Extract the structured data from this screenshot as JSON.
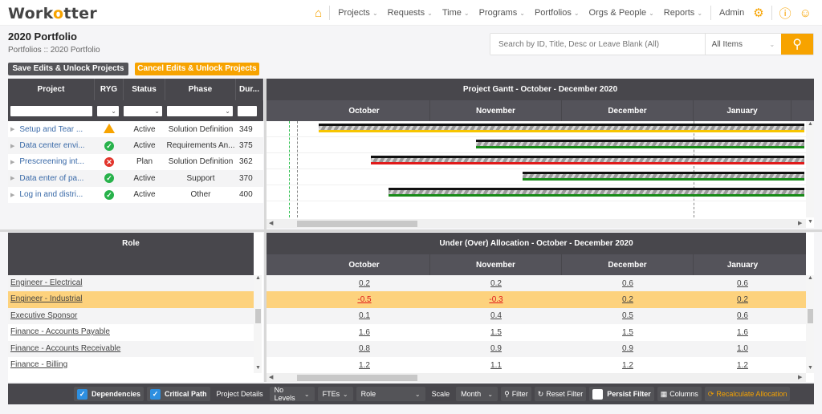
{
  "app": {
    "logo_prefix": "Work",
    "logo_mid": "o",
    "logo_suffix": "tter"
  },
  "nav": {
    "items": [
      {
        "label": "Projects"
      },
      {
        "label": "Requests"
      },
      {
        "label": "Time"
      },
      {
        "label": "Programs"
      },
      {
        "label": "Portfolios"
      },
      {
        "label": "Orgs & People"
      },
      {
        "label": "Reports"
      }
    ],
    "admin_label": "Admin",
    "home_icon": "home-icon",
    "gear_icon": "gear-icon",
    "help_icon": "help-icon",
    "user_icon": "user-icon"
  },
  "page": {
    "title": "2020 Portfolio",
    "breadcrumb": "Portfolios :: 2020 Portfolio"
  },
  "search": {
    "placeholder": "Search by ID, Title, Desc or Leave Blank (All)",
    "scope": "All Items"
  },
  "actions": {
    "save": "Save Edits & Unlock Projects",
    "cancel": "Cancel Edits & Unlock Projects"
  },
  "projects": {
    "columns": [
      "Project",
      "RYG",
      "Status",
      "Phase",
      "Dur..."
    ],
    "rows": [
      {
        "name": "Setup and Tear ...",
        "ryg": "yellow",
        "status": "Active",
        "phase": "Solution Definition",
        "duration": "349"
      },
      {
        "name": "Data center envi...",
        "ryg": "green",
        "status": "Active",
        "phase": "Requirements An...",
        "duration": "375"
      },
      {
        "name": "Prescreening int...",
        "ryg": "red",
        "status": "Plan",
        "phase": "Solution Definition",
        "duration": "362"
      },
      {
        "name": "Data enter of pa...",
        "ryg": "green",
        "status": "Active",
        "phase": "Support",
        "duration": "370"
      },
      {
        "name": "Log in and distri...",
        "ryg": "green",
        "status": "Active",
        "phase": "Other",
        "duration": "400"
      }
    ]
  },
  "gantt": {
    "title": "Project Gantt - October - December 2020",
    "months": [
      "October",
      "November",
      "December",
      "January"
    ],
    "bars": [
      {
        "start_month": 0.15,
        "status": "yellow"
      },
      {
        "start_month": 1.35,
        "status": "green"
      },
      {
        "start_month": 0.55,
        "status": "red"
      },
      {
        "start_month": 1.7,
        "status": "green"
      },
      {
        "start_month": 0.68,
        "status": "green"
      }
    ]
  },
  "roles": {
    "header": "Role",
    "rows": [
      {
        "name": "Engineer - Electrical",
        "selected": false
      },
      {
        "name": "Engineer - Industrial",
        "selected": true
      },
      {
        "name": "Executive Sponsor",
        "selected": false
      },
      {
        "name": "Finance - Accounts Payable",
        "selected": false
      },
      {
        "name": "Finance - Accounts Receivable",
        "selected": false
      },
      {
        "name": "Finance - Billing",
        "selected": false
      }
    ]
  },
  "allocation": {
    "title": "Under (Over) Allocation - October - December 2020",
    "months": [
      "October",
      "November",
      "December",
      "January"
    ],
    "rows": [
      [
        "0.2",
        "0.2",
        "0.6",
        "0.6"
      ],
      [
        "-0.5",
        "-0.3",
        "0.2",
        "0.2"
      ],
      [
        "0.1",
        "0.4",
        "0.5",
        "0.6"
      ],
      [
        "1.6",
        "1.5",
        "1.5",
        "1.6"
      ],
      [
        "0.8",
        "0.9",
        "0.9",
        "1.0"
      ],
      [
        "1.2",
        "1.1",
        "1.2",
        "1.2"
      ]
    ]
  },
  "toolbar": {
    "dependencies": "Dependencies",
    "critical_path": "Critical Path",
    "project_details": "Project Details",
    "levels": "No Levels",
    "unit": "FTEs",
    "group": "Role",
    "scale_label": "Scale",
    "scale": "Month",
    "filter": "Filter",
    "reset_filter": "Reset Filter",
    "persist_filter": "Persist Filter",
    "columns": "Columns",
    "recalculate": "Recalculate Allocation"
  }
}
